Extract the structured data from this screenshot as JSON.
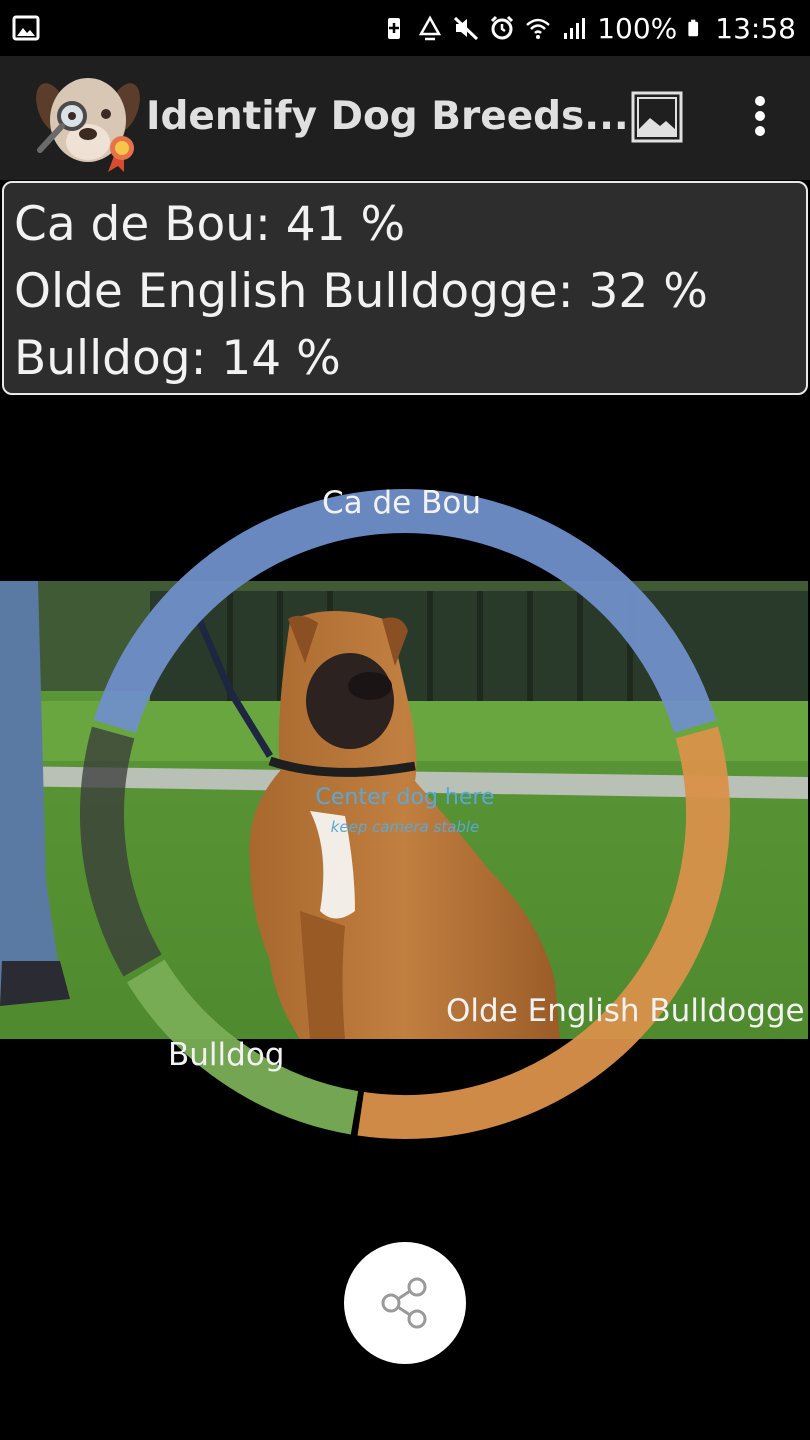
{
  "status_bar": {
    "battery_percent": "100%",
    "clock": "13:58",
    "icons": [
      "gallery-icon",
      "battery-saver-icon",
      "recycle-icon",
      "mute-icon",
      "alarm-icon",
      "wifi-icon",
      "signal-icon",
      "battery-icon"
    ]
  },
  "app_bar": {
    "title": "Identify Dog Breeds...",
    "logo_icon": "dog-magnifier-logo",
    "image_button_icon": "image-icon",
    "menu_icon": "more-vert-icon"
  },
  "results": [
    {
      "breed": "Ca de Bou",
      "percent": 41,
      "text": "Ca de Bou: 41 %"
    },
    {
      "breed": "Olde English Bulldogge",
      "percent": 32,
      "text": "Olde English Bulldogge: 32 %"
    },
    {
      "breed": "Bulldog",
      "percent": 14,
      "text": "Bulldog: 14 %"
    }
  ],
  "ring": {
    "labels": {
      "ca_de_bou": "Ca de Bou",
      "olde_english": "Olde English Bulldogge",
      "bulldog": "Bulldog"
    },
    "colors": {
      "ca_de_bou": "#6f8fc9",
      "olde_english": "#d9914a",
      "bulldog": "#79ae57",
      "other": "#3a3a3a"
    }
  },
  "camera_hint": {
    "title": "Center dog here",
    "subtitle": "keep camera stable"
  },
  "share_button": {
    "icon": "share-icon"
  }
}
